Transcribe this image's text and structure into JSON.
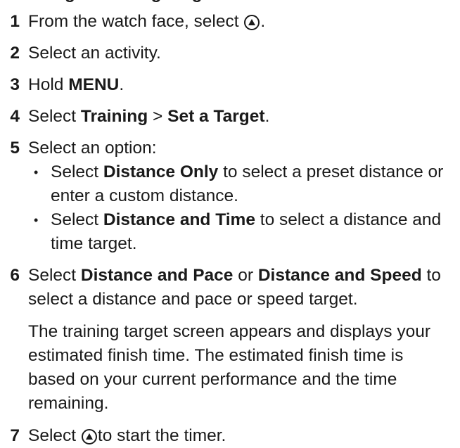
{
  "heading_partial": "Setting a Training Target",
  "steps": [
    {
      "num": "1",
      "text_a": "From the watch face, select ",
      "text_b": "."
    },
    {
      "num": "2",
      "text": "Select an activity."
    },
    {
      "num": "3",
      "pre": "Hold ",
      "bold": "MENU",
      "post": "."
    },
    {
      "num": "4",
      "pre": "Select ",
      "bold1": "Training",
      "mid": " > ",
      "bold2": "Set a Target",
      "post": "."
    },
    {
      "num": "5",
      "text": "Select an option:"
    },
    {
      "num": "6",
      "pre": "Select ",
      "bold1": "Distance and Pace",
      "mid": " or ",
      "bold2": "Distance and Speed",
      "post": " to select a distance and pace or speed target."
    },
    {
      "num": "7",
      "pre": "Select ",
      "post": "to start the timer."
    }
  ],
  "options": [
    {
      "pre": "Select ",
      "bold": "Distance Only",
      "post": " to select a preset distance or enter a custom distance."
    },
    {
      "pre": "Select ",
      "bold": "Distance and Time",
      "post": " to select a distance and time target."
    }
  ],
  "bullet_glyph": "•",
  "note": "The training target screen appears and displays your estimated finish time. The estimated finish time is based on your current performance and the time remaining.",
  "icons": {
    "start_button": "up-triangle-button-icon"
  }
}
